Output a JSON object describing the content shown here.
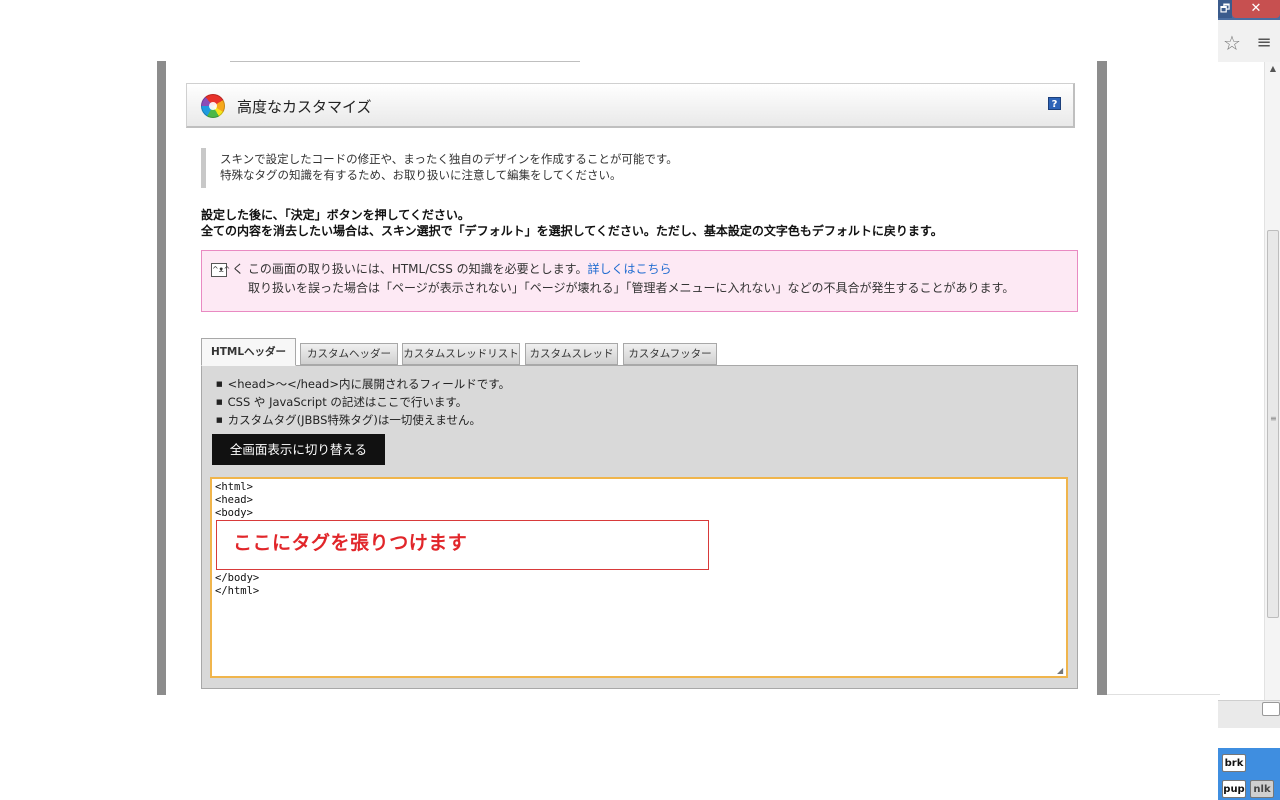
{
  "browser": {
    "restore_glyph": "🗗",
    "close_glyph": "✕",
    "star_icon": "☆",
    "menu_icon": "≡",
    "extensions": [
      "brk",
      "pup",
      "nlk"
    ]
  },
  "header": {
    "title": "高度なカスタマイズ",
    "help_label": "?"
  },
  "note": {
    "line1": "スキンで設定したコードの修正や、まったく独自のデザインを作成することが可能です。",
    "line2": "特殊なタグの知識を有するため、お取り扱いに注意して編集をしてください。"
  },
  "instructions": {
    "line1": "設定した後に、「決定」ボタンを押してください。",
    "line2": "全ての内容を消去したい場合は、スキン選択で「デフォルト」を選択してください。ただし、基本設定の文字色もデフォルトに戻ります。"
  },
  "warning": {
    "line1_text": "く この画面の取り扱いには、HTML/CSS の知識を必要とします。",
    "link_text": "詳しくはこちら",
    "line2": "取り扱いを誤った場合は「ページが表示されない」「ページが壊れる」「管理者メニューに入れない」などの不具合が発生することがあります。"
  },
  "tabs": [
    {
      "label": "HTMLヘッダー",
      "active": true
    },
    {
      "label": "カスタムヘッダー",
      "active": false
    },
    {
      "label": "カスタムスレッドリスト",
      "active": false
    },
    {
      "label": "カスタムスレッド",
      "active": false
    },
    {
      "label": "カスタムフッター",
      "active": false
    }
  ],
  "panel": {
    "bullets": [
      "<head>〜</head>内に展開されるフィールドです。",
      "CSS や JavaScript の記述はここで行います。",
      "カスタムタグ(JBBS特殊タグ)は一切使えません。"
    ],
    "fullscreen_button": "全画面表示に切り替える"
  },
  "editor": {
    "lines_before": [
      "<html>",
      "<head>",
      "<body>"
    ],
    "lines_after": [
      "</body>",
      "</html>"
    ],
    "annotation": "ここにタグを張りつけます"
  },
  "colors": {
    "warning_bg": "#fde9f4",
    "warning_border": "#e98ac2",
    "editor_border": "#f0b54c",
    "annotation_red": "#e1262a",
    "link_blue": "#1f6bd0"
  }
}
